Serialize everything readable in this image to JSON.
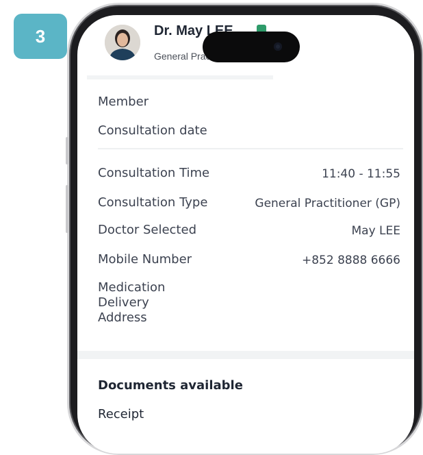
{
  "step_badge": "3",
  "header": {
    "doctor_name": "Dr. May LEE",
    "specialty": "General Practitioner"
  },
  "details": {
    "member_label": "Member",
    "consultation_date_label": "Consultation date",
    "rows": [
      {
        "label": "Consultation Time",
        "value": "11:40 - 11:55"
      },
      {
        "label": "Consultation Type",
        "value": "General Practitioner (GP)"
      },
      {
        "label": "Doctor Selected",
        "value": "May LEE"
      },
      {
        "label": "Mobile Number",
        "value": "+852 8888 6666"
      }
    ],
    "address_label_lines": [
      "Medication",
      "Delivery",
      "Address"
    ]
  },
  "documents": {
    "title": "Documents available",
    "items": [
      "Receipt"
    ]
  },
  "colors": {
    "badge": "#5bb5c6",
    "status_dot": "#2e9b6a",
    "text": "#3c4250"
  }
}
